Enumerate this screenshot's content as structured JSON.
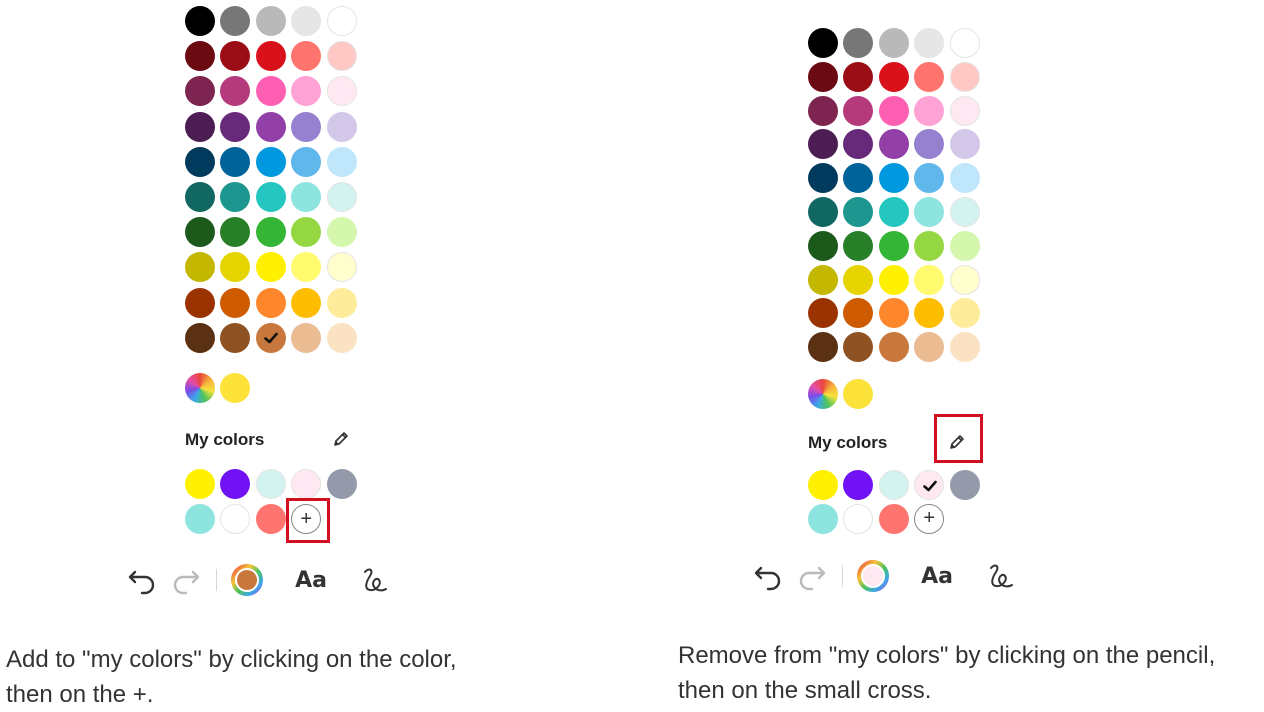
{
  "palette": [
    [
      "#000000",
      "#777777",
      "#b9b9b9",
      "#e6e6e6",
      "#ffffff"
    ],
    [
      "#6b0a12",
      "#9b0e15",
      "#d8111b",
      "#ff746e",
      "#ffc8c4"
    ],
    [
      "#7d2450",
      "#b53a7b",
      "#fe5fb3",
      "#ffa3d7",
      "#ffe8f2"
    ],
    [
      "#4b1d53",
      "#672a7a",
      "#933fa8",
      "#9681d0",
      "#d3c7ea"
    ],
    [
      "#003a5d",
      "#00639a",
      "#0098df",
      "#5fb7ec",
      "#bfe6fb"
    ],
    [
      "#116863",
      "#1c968e",
      "#24c6bf",
      "#8ee4df",
      "#d3f3f1"
    ],
    [
      "#1c5a1c",
      "#277f27",
      "#35b535",
      "#94d742",
      "#d4f6ad"
    ],
    [
      "#c4b700",
      "#e5d400",
      "#fff000",
      "#fffa6e",
      "#fffecc"
    ],
    [
      "#9b3300",
      "#cf5b00",
      "#ff872b",
      "#ffbd00",
      "#ffec9b"
    ],
    [
      "#5a3113",
      "#8f5222",
      "#c8783c",
      "#ebbb92",
      "#fbe2c3"
    ]
  ],
  "light_colors": [
    "#ffffff",
    "#e6e6e6",
    "#ffe8f2",
    "#d3f3f1",
    "#fffecc",
    "#ffc8c4"
  ],
  "custom_color": "#fde23a",
  "my_colors_label": "My colors",
  "left": {
    "selected_palette": [
      9,
      2
    ],
    "my_colors": [
      "#fff000",
      "#7112f5",
      "#d3f3f1",
      "#ffe8f2",
      "#949aa9",
      "#8ee4df",
      "#ffffff",
      "#ff746e"
    ],
    "selected_my_color": -1,
    "current_color": "#c8783c",
    "caption_line1": "Add to \"my colors\" by clicking on the color,",
    "caption_line2": "then on the +."
  },
  "right": {
    "selected_palette": null,
    "my_colors": [
      "#fff000",
      "#7112f5",
      "#d3f3f1",
      "#ffe8f2",
      "#949aa9",
      "#8ee4df",
      "#ffffff",
      "#ff746e"
    ],
    "selected_my_color": 3,
    "current_color": "#ffe8f2",
    "caption_line1": "Remove from \"my colors\" by clicking on the pencil,",
    "caption_line2": "then on the small cross."
  },
  "toolbar": {
    "undo_icon": "undo-icon",
    "redo_icon": "redo-icon",
    "color_icon": "color-ring-icon",
    "font_label": "Aa",
    "pen_icon": "handwriting-icon"
  },
  "add_label": "+",
  "highlight_color": "#d0101f"
}
